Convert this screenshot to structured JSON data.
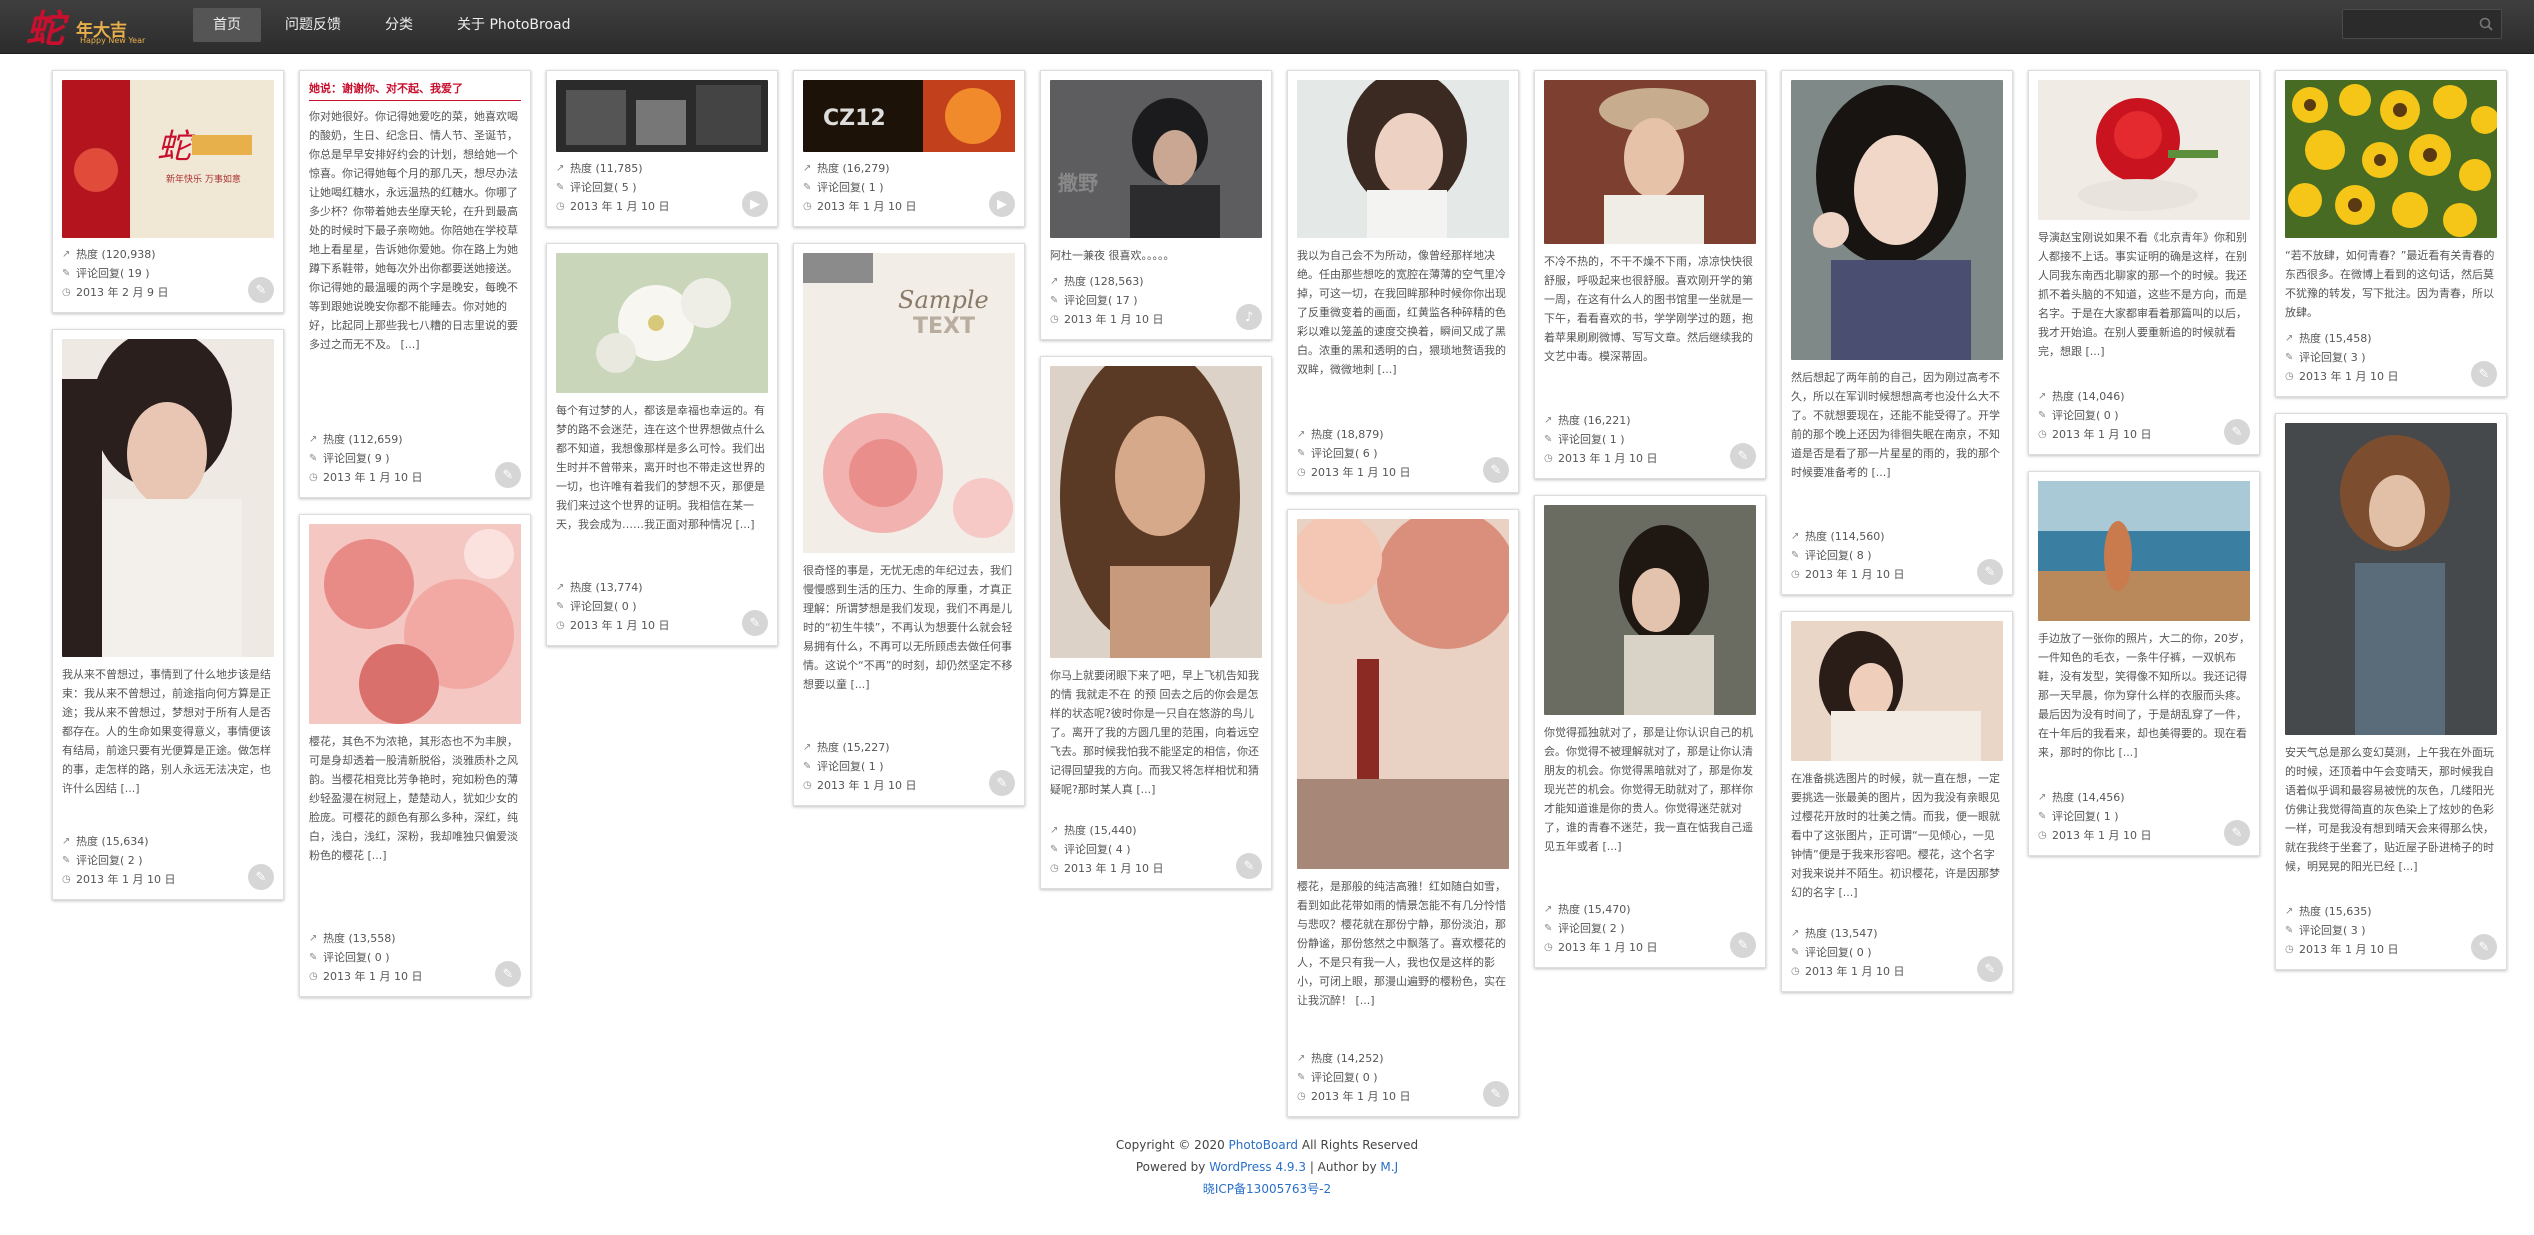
{
  "header": {
    "logo_glyph": "蛇",
    "logo_text": "年大吉",
    "logo_tagline": "Happy New Year",
    "nav": [
      "首页",
      "问题反馈",
      "分类",
      "关于 PhotoBroad"
    ],
    "search": {
      "placeholder": ""
    }
  },
  "labels": {
    "heat": "热度",
    "comments": "评论回复"
  },
  "cards": [
    {
      "heat": "热度 (120,938)",
      "comments": "评论回复( 19 )",
      "date": "2013 年 2 月 9 日"
    },
    {
      "excerpt": "我从来不曾想过，事情到了什么地步该是结束：我从来不曾想过，前途指向何方算是正途；我从来不曾想过，梦想对于所有人是否都存在。人的生命如果变得意义，事情便该有结局，前途只要有光便算是正途。做怎样的事，走怎样的路，别人永远无法决定，也许什么因结 [...]",
      "heat": "热度 (15,634)",
      "comments": "评论回复( 2 )",
      "date": "2013 年 1 月 10 日"
    },
    {
      "title": "她说：谢谢你、对不起、我爱了",
      "excerpt": "你对她很好。你记得她爱吃的菜，她喜欢喝的酸奶，生日、纪念日、情人节、圣诞节，你总是早早安排好约会的计划，想给她一个惊喜。你记得她每个月的那几天，想尽办法让她喝红糖水，永远温热的红糖水。你哪了多少杯？你带着她去坐摩天轮，在升到最高处的时候时下最子亲吻她。你陪她在学校草地上看星星，告诉她你爱她。你在路上为她蹲下系鞋带，她每次外出你都要送她接送。你记得她的最温暖的两个字是晚安，每晚不等到跟她说晚安你都不能睡去。你对她的好，比起同上那些我七八糟的日志里说的要多过之而无不及。 [...]",
      "heat": "热度 (112,659)",
      "comments": "评论回复( 9 )",
      "date": "2013 年 1 月 10 日"
    },
    {
      "excerpt": "樱花，其色不为浓艳，其形态也不为丰腴，可是身却透着一股清新脱俗，淡雅质朴之风韵。当樱花相竞比芳争艳时，宛如粉色的薄纱轻盈漫在树冠上，楚楚动人，犹如少女的脸庞。可樱花的颜色有那么多种，深红，纯白，浅白，浅红，深粉，我却唯独只偏爱淡粉色的樱花 [...]",
      "heat": "热度 (13,558)",
      "comments": "评论回复( 0 )",
      "date": "2013 年 1 月 10 日"
    },
    {
      "heat": "热度 (11,785)",
      "comments": "评论回复( 5 )",
      "date": "2013 年 1 月 10 日"
    },
    {
      "excerpt": "每个有过梦的人，都该是幸福也幸运的。有梦的路不会迷茫，连在这个世界想做点什么都不知道，我想像那样是多么可怜。我们出生时并不曾带来，离开时也不带走这世界的一切，也许唯有着我们的梦想不灭，那便是我们来过这个世界的证明。我相信在某一天，我会成为……我正面对那种情况 [...]",
      "heat": "热度 (13,774)",
      "comments": "评论回复( 0 )",
      "date": "2013 年 1 月 10 日"
    },
    {
      "heat": "热度 (16,279)",
      "comments": "评论回复( 1 )",
      "date": "2013 年 1 月 10 日"
    },
    {
      "excerpt": "很奇怪的事是，无忧无虑的年纪过去，我们慢慢感到生活的压力、生命的厚重，才真正理解：所谓梦想是我们发现，我们不再是儿时的“初生牛犊”，不再认为想要什么就会轻易拥有什么，不再可以无所顾虑去做任何事情。这说个“不再”的时刻，却仍然坚定不移想要以童 [...]",
      "heat": "热度 (15,227)",
      "comments": "评论回复( 1 )",
      "date": "2013 年 1 月 10 日"
    },
    {
      "excerpt": "阿杜一兼夜 很喜欢。。。。。",
      "heat": "热度 (128,563)",
      "comments": "评论回复( 17 )",
      "date": "2013 年 1 月 10 日"
    },
    {
      "excerpt": "你马上就要闭眼下来了吧，早上飞机告知我的情 我就走不在 的预 回去之后的你会是怎样的状态呢?彼时你是一只自在悠游的鸟儿了。离开了我的方圆几里的范围，向着远空飞去。那时候我怕我不能坚定的相信，你还记得回望我的方向。而我又将怎样相忧和猜疑呢?那时某人真 [...]",
      "heat": "热度 (15,440)",
      "comments": "评论回复( 4 )",
      "date": "2013 年 1 月 10 日"
    },
    {
      "excerpt": "我以为自己会不为所动，像曾经那样地决绝。任由那些想吃的宽腔在薄薄的空气里冷掉，可这一切，在我回眸那种时候你你出现了反重微变着的画面，红黄监各种碎精的色彩以难以笼盖的速度交换着，瞬间又成了黑白。浓重的黑和透明的白，猥琐地赘语我的双眸，微微地刺 [...]",
      "heat": "热度 (18,879)",
      "comments": "评论回复( 6 )",
      "date": "2013 年 1 月 10 日"
    },
    {
      "excerpt": "樱花，是那般的纯洁高雅！红如随白如雪，看到如此花带如雨的情景怎能不有几分怜惜与悲叹？樱花就在那份宁静，那份淡泊，那份静谧，那份悠然之中飘落了。喜欢樱花的人，不是只有我一人，我也仅是这样的影小，可闭上眼，那漫山遍野的樱粉色，实在让我沉醉！ [...]",
      "heat": "热度 (14,252)",
      "comments": "评论回复( 0 )",
      "date": "2013 年 1 月 10 日"
    },
    {
      "excerpt": "不冷不热的，不干不燥不下雨，凉凉快快很舒服，呼吸起来也很舒服。喜欢刚开学的第一周，在这有什么人的图书馆里一坐就是一下午，看看喜欢的书，学学刚学过的题，抱着苹果刷刷微博、写写文章。然后继续我的文艺中毒。模深蒂固。",
      "heat": "热度 (16,221)",
      "comments": "评论回复( 1 )",
      "date": "2013 年 1 月 10 日"
    },
    {
      "excerpt": "你觉得孤独就对了，那是让你认识自己的机会。你觉得不被理解就对了，那是让你认清朋友的机会。你觉得黑暗就对了，那是你发现光芒的机会。你觉得无助就对了，那样你才能知道谁是你的贵人。你觉得迷茫就对了，谁的青春不迷茫，我一直在惦我自己遥见五年或者 [...]",
      "heat": "热度 (15,470)",
      "comments": "评论回复( 2 )",
      "date": "2013 年 1 月 10 日"
    },
    {
      "excerpt": "然后想起了两年前的自己，因为刚过高考不久，所以在军训时候想想高考也没什么大不了。不就想要现在，还能不能受得了。开学前的那个晚上还因为徘徊失眠在南京，不知道是否是看了那一片星星的雨的，我的那个时候要准备考的 [...]",
      "heat": "热度 (114,560)",
      "comments": "评论回复( 8 )",
      "date": "2013 年 1 月 10 日"
    },
    {
      "excerpt": "在准备挑选图片的时候，就一直在想，一定要挑选一张最美的图片，因为我没有亲眼见过樱花开放时的壮美之情。而我，便一眼就看中了这张图片，正可谓“一见倾心，一见钟情”便是于我来形容吧。樱花，这个名字对我来说并不陌生。初识樱花，许是因那梦幻的名字 [...]",
      "heat": "热度 (13,547)",
      "comments": "评论回复( 0 )",
      "date": "2013 年 1 月 10 日"
    },
    {
      "excerpt": "导演赵宝刚说如果不看《北京青年》你和别人都接不上话。事实证明的确是这样，在别人同我东南西北聊家的那一个的时候。我还抓不着头脑的不知道，这些不是方向，而是名字。于是在大家都审看着那篇叫的以后，我才开始追。在别人要重新追的时候就看完，想跟 [...]",
      "heat": "热度 (14,046)",
      "comments": "评论回复( 0 )",
      "date": "2013 年 1 月 10 日"
    },
    {
      "excerpt": "手边放了一张你的照片，大二的你，20岁，一件知色的毛衣，一条牛仔裤，一双帆布鞋，没有发型，笑得像不知所以。我还记得那一天早晨，你为穿什么样的衣服而头疼。最后因为没有时间了，于是胡乱穿了一件，在十年后的我看来，却也美得要的。现在看来，那时的你比 [...]",
      "heat": "热度 (14,456)",
      "comments": "评论回复( 1 )",
      "date": "2013 年 1 月 10 日"
    },
    {
      "excerpt": "“若不放肆，如何青春？”最近看有关青春的东西很多。在微博上看到的这句话，然后莫不犹豫的转发，写下批注。因为青春，所以放肆。",
      "heat": "热度 (15,458)",
      "comments": "评论回复( 3 )",
      "date": "2013 年 1 月 10 日"
    },
    {
      "excerpt": "安天气总是那么变幻莫测，上午我在外面玩的时候，还顶着中午会变晴天，那时候我自语着似乎调和最容易被恍的灰色，几缕阳光仿佛让我觉得简直的灰色染上了炫妙的色彩一样，可是我没有想到晴天会来得那么快，就在我终于坐套了，贴近屋子卧进椅子的时候，明晃晃的阳光已经 [...]",
      "heat": "热度 (15,635)",
      "comments": "评论回复( 3 )",
      "date": "2013 年 1 月 10 日"
    }
  ],
  "footer": {
    "copyright_pre": "Copyright © 2020 ",
    "site": "PhotoBoard",
    "copyright_post": " All Rights Reserved",
    "powered_pre": "Powered by ",
    "wp": "WordPress 4.9.3",
    "author_pre": " | Author by ",
    "author": "M.J",
    "icp": "晓ICP备13005763号-2"
  },
  "colors": {
    "accent": "#c8102e",
    "link": "#2a6fc9",
    "topbar": "#333333"
  }
}
